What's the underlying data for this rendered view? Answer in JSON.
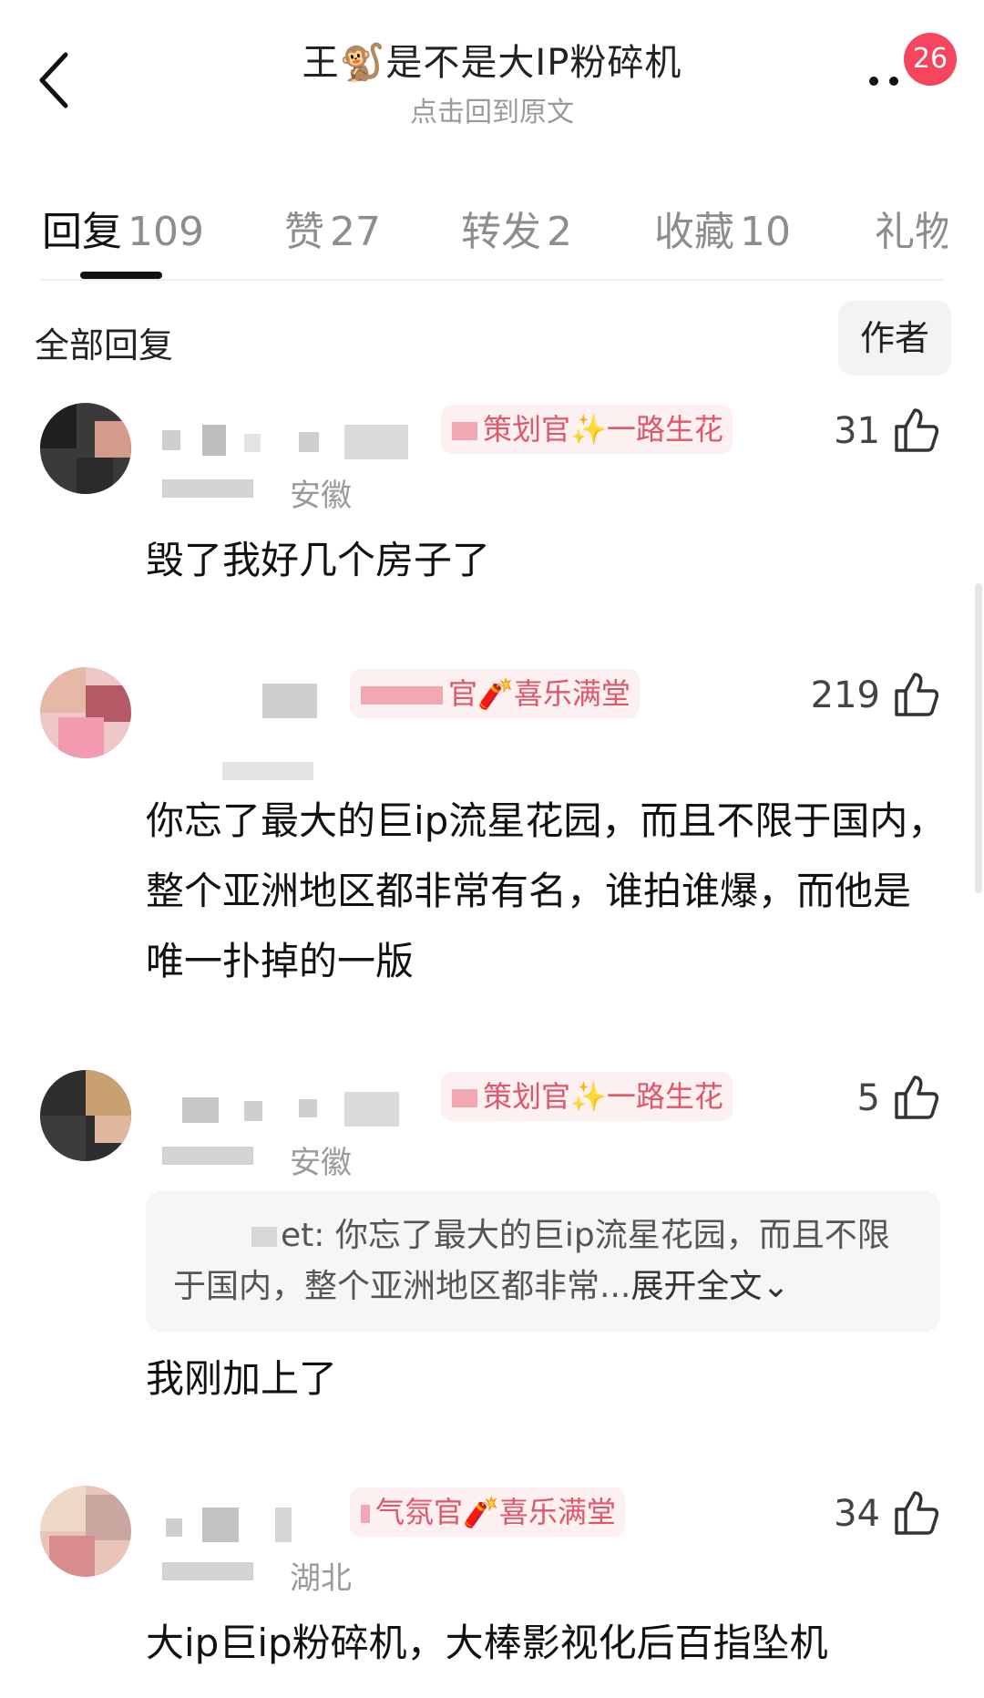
{
  "header": {
    "back_icon": "chevron-left-icon",
    "title": "王🐒是不是大IP粉碎机",
    "subtitle": "点击回到原文",
    "more_icon": "more-dots-icon",
    "badge_count": "26",
    "badge_color": "#f4475f"
  },
  "tabs": [
    {
      "label": "回复",
      "count": "109",
      "active": true
    },
    {
      "label": "赞",
      "count": "27"
    },
    {
      "label": "转发",
      "count": "2"
    },
    {
      "label": "收藏",
      "count": "10"
    },
    {
      "label": "礼物",
      "count": ""
    }
  ],
  "filter": {
    "all_replies": "全部回复",
    "author": "作者"
  },
  "comments": [
    {
      "title_tag": "策划官✨一路生花",
      "likes": "31",
      "location": "安徽",
      "text": "毁了我好几个房子了"
    },
    {
      "title_tag": "官🧨喜乐满堂",
      "likes": "219",
      "location": "",
      "text": "你忘了最大的巨ip流星花园，而且不限于国内，整个亚洲地区都非常有名，谁拍谁爆，而他是唯一扑掉的一版"
    },
    {
      "title_tag": "策划官✨一路生花",
      "likes": "5",
      "location": "安徽",
      "quote": {
        "prefix": "et: ",
        "text": "你忘了最大的巨ip流星花园，而且不限于国内，整个亚洲地区都非常...",
        "expand": "展开全文"
      },
      "text": "我刚加上了"
    },
    {
      "title_tag": "气氛官🧨喜乐满堂",
      "likes": "34",
      "location": "湖北",
      "text": "大ip巨ip粉碎机，大棒影视化后百指坠机"
    }
  ],
  "colors": {
    "accent": "#f4475f",
    "tag_text": "#e0566a",
    "tag_bg": "#fdf0f0"
  }
}
